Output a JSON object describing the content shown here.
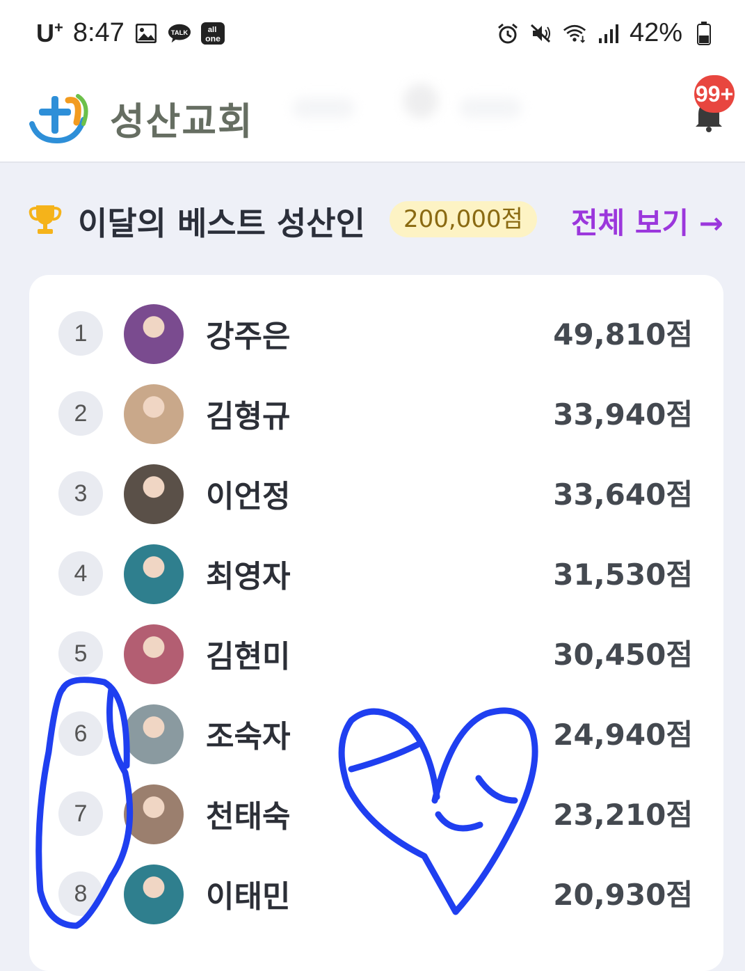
{
  "status_bar": {
    "carrier": "U",
    "carrier_sup": "+",
    "time": "8:47",
    "battery": "42%",
    "left_icons": [
      "gallery-icon",
      "kakaotalk-icon",
      "allinone-icon"
    ],
    "right_icons": [
      "alarm-icon",
      "mute-icon",
      "wifi-icon",
      "signal-icon",
      "battery-icon"
    ]
  },
  "app_bar": {
    "title": "성산교회",
    "notification_count": "99+"
  },
  "ranking": {
    "title": "이달의 베스트 성산인",
    "points_pill": "200,000점",
    "view_all": "전체 보기 →",
    "rows": [
      {
        "rank": "1",
        "name": "강주은",
        "score": "49,810점",
        "avatar_color": "#7a4b8f"
      },
      {
        "rank": "2",
        "name": "김형규",
        "score": "33,940점",
        "avatar_color": "#c9a88a"
      },
      {
        "rank": "3",
        "name": "이언정",
        "score": "33,640점",
        "avatar_color": "#5a5048"
      },
      {
        "rank": "4",
        "name": "최영자",
        "score": "31,530점",
        "avatar_color": "#2f7f8e"
      },
      {
        "rank": "5",
        "name": "김현미",
        "score": "30,450점",
        "avatar_color": "#b35e72"
      },
      {
        "rank": "6",
        "name": "조숙자",
        "score": "24,940점",
        "avatar_color": "#8a9aa0"
      },
      {
        "rank": "7",
        "name": "천태숙",
        "score": "23,210점",
        "avatar_color": "#9b7f6e"
      },
      {
        "rank": "8",
        "name": "이태민",
        "score": "20,930점",
        "avatar_color": "#2f7f8e"
      }
    ]
  },
  "colors": {
    "accent_purple": "#9b37dc",
    "badge_red": "#e8463f",
    "scribble_blue": "#1f3ff0"
  }
}
